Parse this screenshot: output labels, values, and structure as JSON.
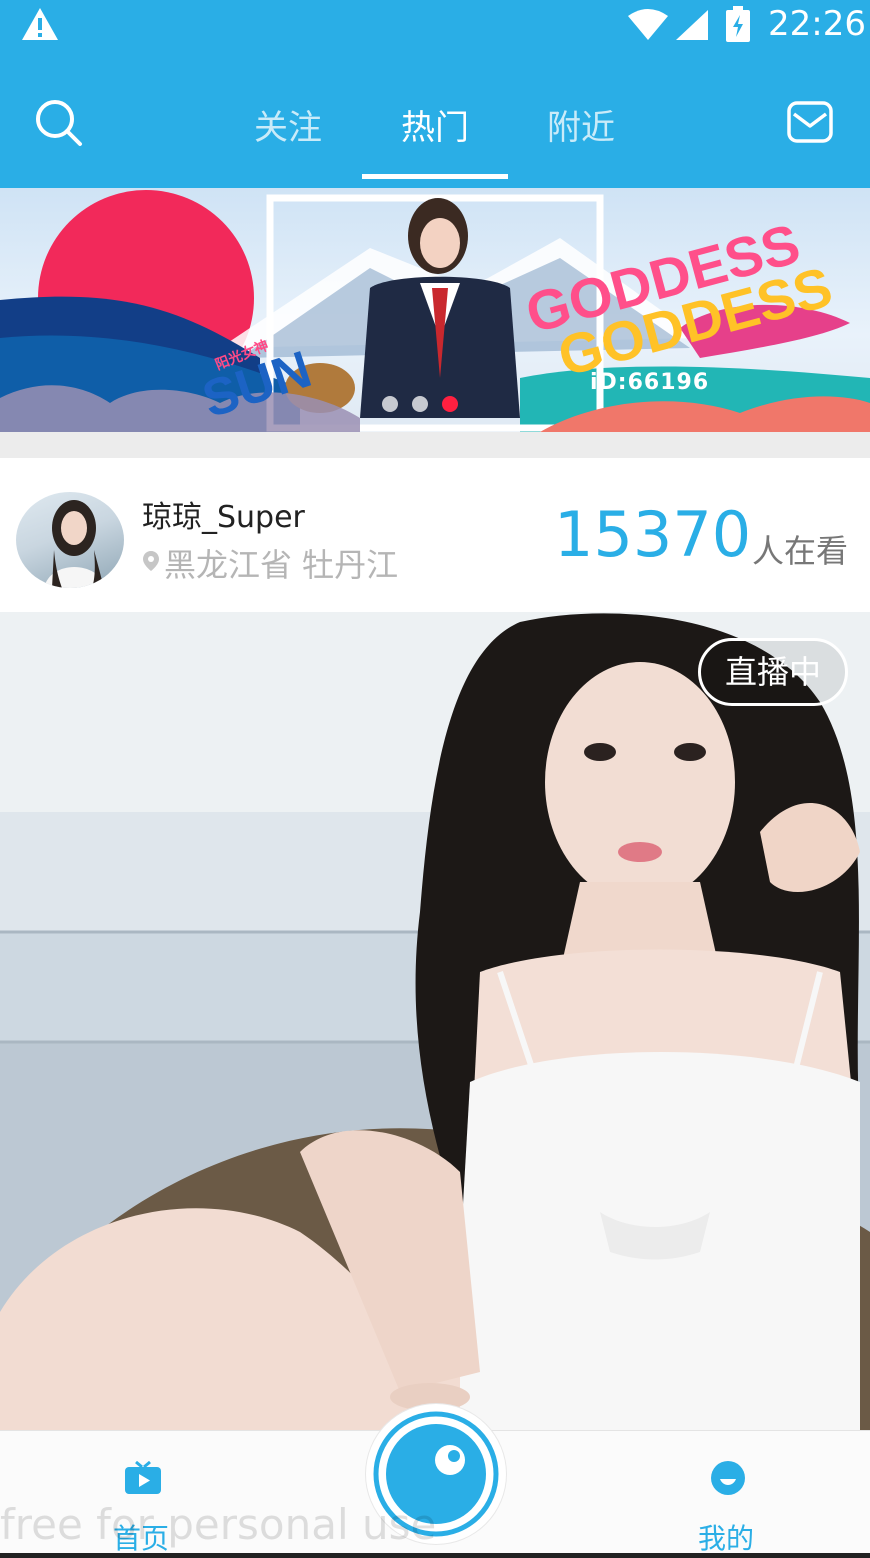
{
  "status_bar": {
    "time": "22:26",
    "icons": [
      "warning-icon",
      "wifi-icon",
      "signal-icon",
      "battery-charging-icon"
    ]
  },
  "header": {
    "tabs": [
      {
        "label": "关注",
        "active": false
      },
      {
        "label": "热门",
        "active": true
      },
      {
        "label": "附近",
        "active": false
      }
    ],
    "left_icon": "search-icon",
    "right_icon": "mail-icon"
  },
  "banner": {
    "id_text": "iD:66196",
    "small_text": "阳光女神",
    "headline": "GODDESS",
    "page_index": 3,
    "page_count": 3
  },
  "live_card": {
    "streamer_name": "琼琼_Super",
    "location": "黑龙江省 牡丹江",
    "viewer_count": "15370",
    "viewer_suffix": "人在看",
    "live_badge": "直播中"
  },
  "bottom_nav": {
    "home_label": "首页",
    "me_label": "我的",
    "center_icon": "camera-icon"
  },
  "watermark": "free for personal use",
  "colors": {
    "primary": "#2aaee6",
    "live_dot_active": "#ff2040",
    "location_text": "#b5b5b5"
  }
}
